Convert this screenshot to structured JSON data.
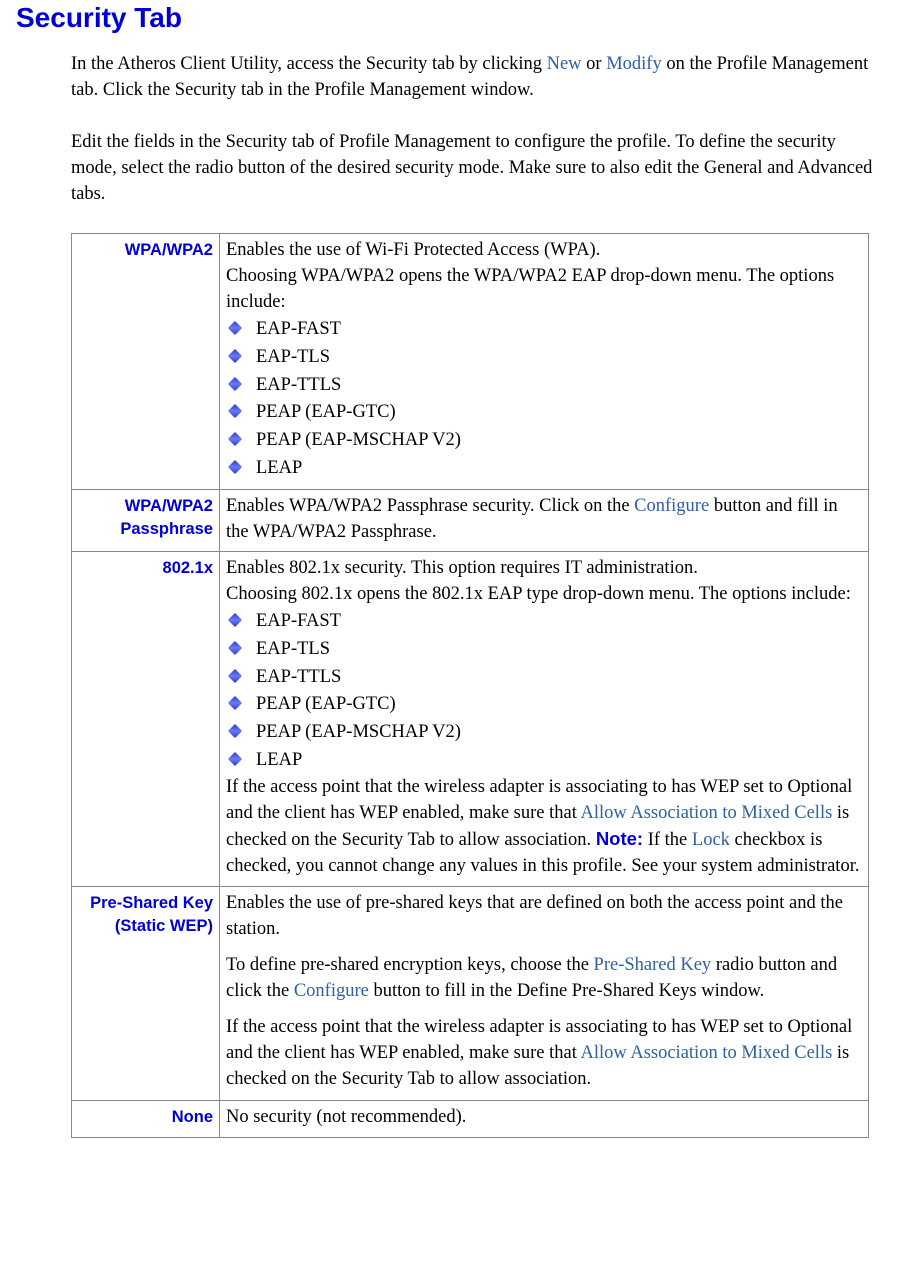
{
  "title": "Security Tab",
  "intro": {
    "p1_a": "In the Atheros Client Utility, access the Security tab by clicking ",
    "link_new": "New",
    "p1_b": " or ",
    "link_modify": "Modify",
    "p1_c": " on the Profile Management tab.  Click the Security tab in the Profile Management window.",
    "p2": "Edit the fields in the Security  tab of Profile Management  to configure the profile. To define the security mode, select the radio button of the desired security mode. Make sure to also edit the General and Advanced tabs."
  },
  "rows": {
    "wpa": {
      "label": "WPA/WPA2",
      "lead": "Enables the use of Wi-Fi Protected Access (WPA).",
      "sub": "Choosing WPA/WPA2 opens the WPA/WPA2 EAP drop-down menu. The options include:",
      "items": [
        "EAP-FAST",
        "EAP-TLS",
        "EAP-TTLS",
        "PEAP (EAP-GTC)",
        "PEAP (EAP-MSCHAP V2)",
        "LEAP"
      ]
    },
    "wpa_pass": {
      "label": "WPA/WPA2 Passphrase",
      "a": "Enables WPA/WPA2 Passphrase security.   Click on the ",
      "link_configure": "Configure",
      "b": " button and fill in the WPA/WPA2 Passphrase."
    },
    "dot1x": {
      "label": "802.1x",
      "lead": "Enables 802.1x security.  This option requires IT administration.",
      "sub": "Choosing 802.1x opens the 802.1x EAP type drop-down menu.  The options include:",
      "items": [
        "EAP-FAST",
        "EAP-TLS",
        "EAP-TTLS",
        "PEAP (EAP-GTC)",
        "PEAP (EAP-MSCHAP V2)",
        "LEAP"
      ],
      "tail_a": "If the access point that the wireless adapter is associating to has WEP set to Optional and the client has WEP enabled, make sure that ",
      "link_mixed": "Allow Association to Mixed Cells",
      "tail_b": " is checked on the Security Tab to allow association. ",
      "note_label": "Note:",
      "tail_c": " If the ",
      "link_lock": "Lock",
      "tail_d": " checkbox is checked, you cannot change any values in this profile. See your system administrator."
    },
    "psk": {
      "label": "Pre-Shared Key (Static WEP)",
      "p1": "Enables the use of pre-shared keys that are defined on both the access point and the station.",
      "p2_a": "To define pre-shared encryption keys, choose the ",
      "link_psk": "Pre-Shared Key",
      "p2_b": " radio button and click the ",
      "link_configure": "Configure",
      "p2_c": " button to fill in the Define Pre-Shared Keys window.",
      "p3_a": "If the access point that the wireless adapter is associating to has WEP set to Optional and the client has WEP enabled, make sure that ",
      "link_mixed": "Allow Association to Mixed Cells",
      "p3_b": " is checked on the Security Tab to allow association."
    },
    "none": {
      "label": "None",
      "text": "No security (not recommended)."
    }
  }
}
